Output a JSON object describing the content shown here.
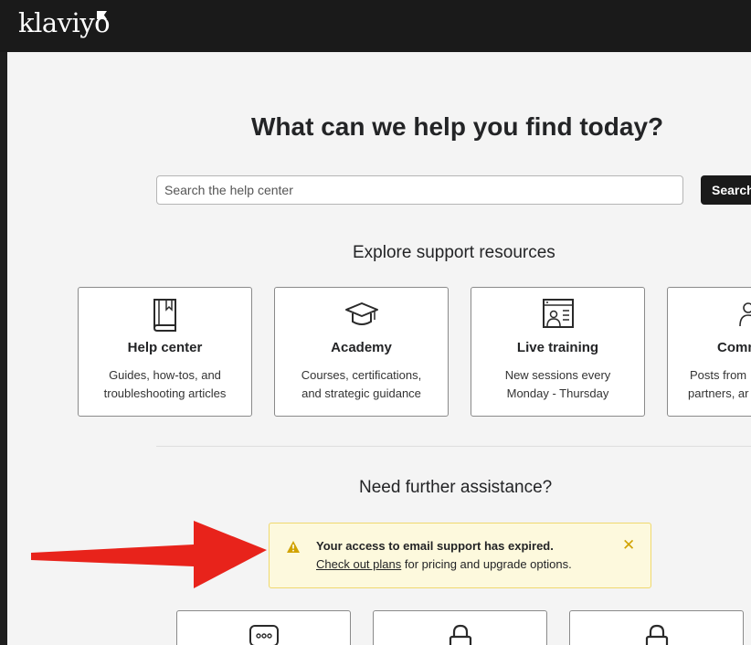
{
  "topbar": {
    "logo_text": "klaviyo"
  },
  "main": {
    "headline": "What can we help you find today?",
    "search": {
      "placeholder": "Search the help center",
      "value": "",
      "button_label": "Search"
    },
    "resources_title": "Explore support resources",
    "cards": [
      {
        "icon": "book-icon",
        "title": "Help center",
        "line1": "Guides, how-tos, and",
        "line2": "troubleshooting articles"
      },
      {
        "icon": "graduation-cap-icon",
        "title": "Academy",
        "line1": "Courses, certifications,",
        "line2": "and strategic guidance"
      },
      {
        "icon": "presentation-icon",
        "title": "Live training",
        "line1": "New sessions every",
        "line2": "Monday - Thursday"
      },
      {
        "icon": "people-icon",
        "title": "Comm",
        "line1": "Posts from",
        "line2": "partners, ar"
      }
    ],
    "assistance_title": "Need further assistance?",
    "alert": {
      "title": "Your access to email support has expired.",
      "link_text": "Check out plans",
      "body_rest": " for pricing and upgrade options.",
      "close_symbol": "✕"
    },
    "bottom_cards": [
      {
        "icon": "chat-bubble-icon"
      },
      {
        "icon": "lock-icon"
      },
      {
        "icon": "lock-icon"
      }
    ]
  },
  "annotation": {
    "arrow_color": "#e8231b"
  },
  "colors": {
    "alert_bg": "#fdf9dd",
    "alert_border": "#efd86e",
    "warning": "#d1a300",
    "topbar": "#1a1a1a"
  }
}
